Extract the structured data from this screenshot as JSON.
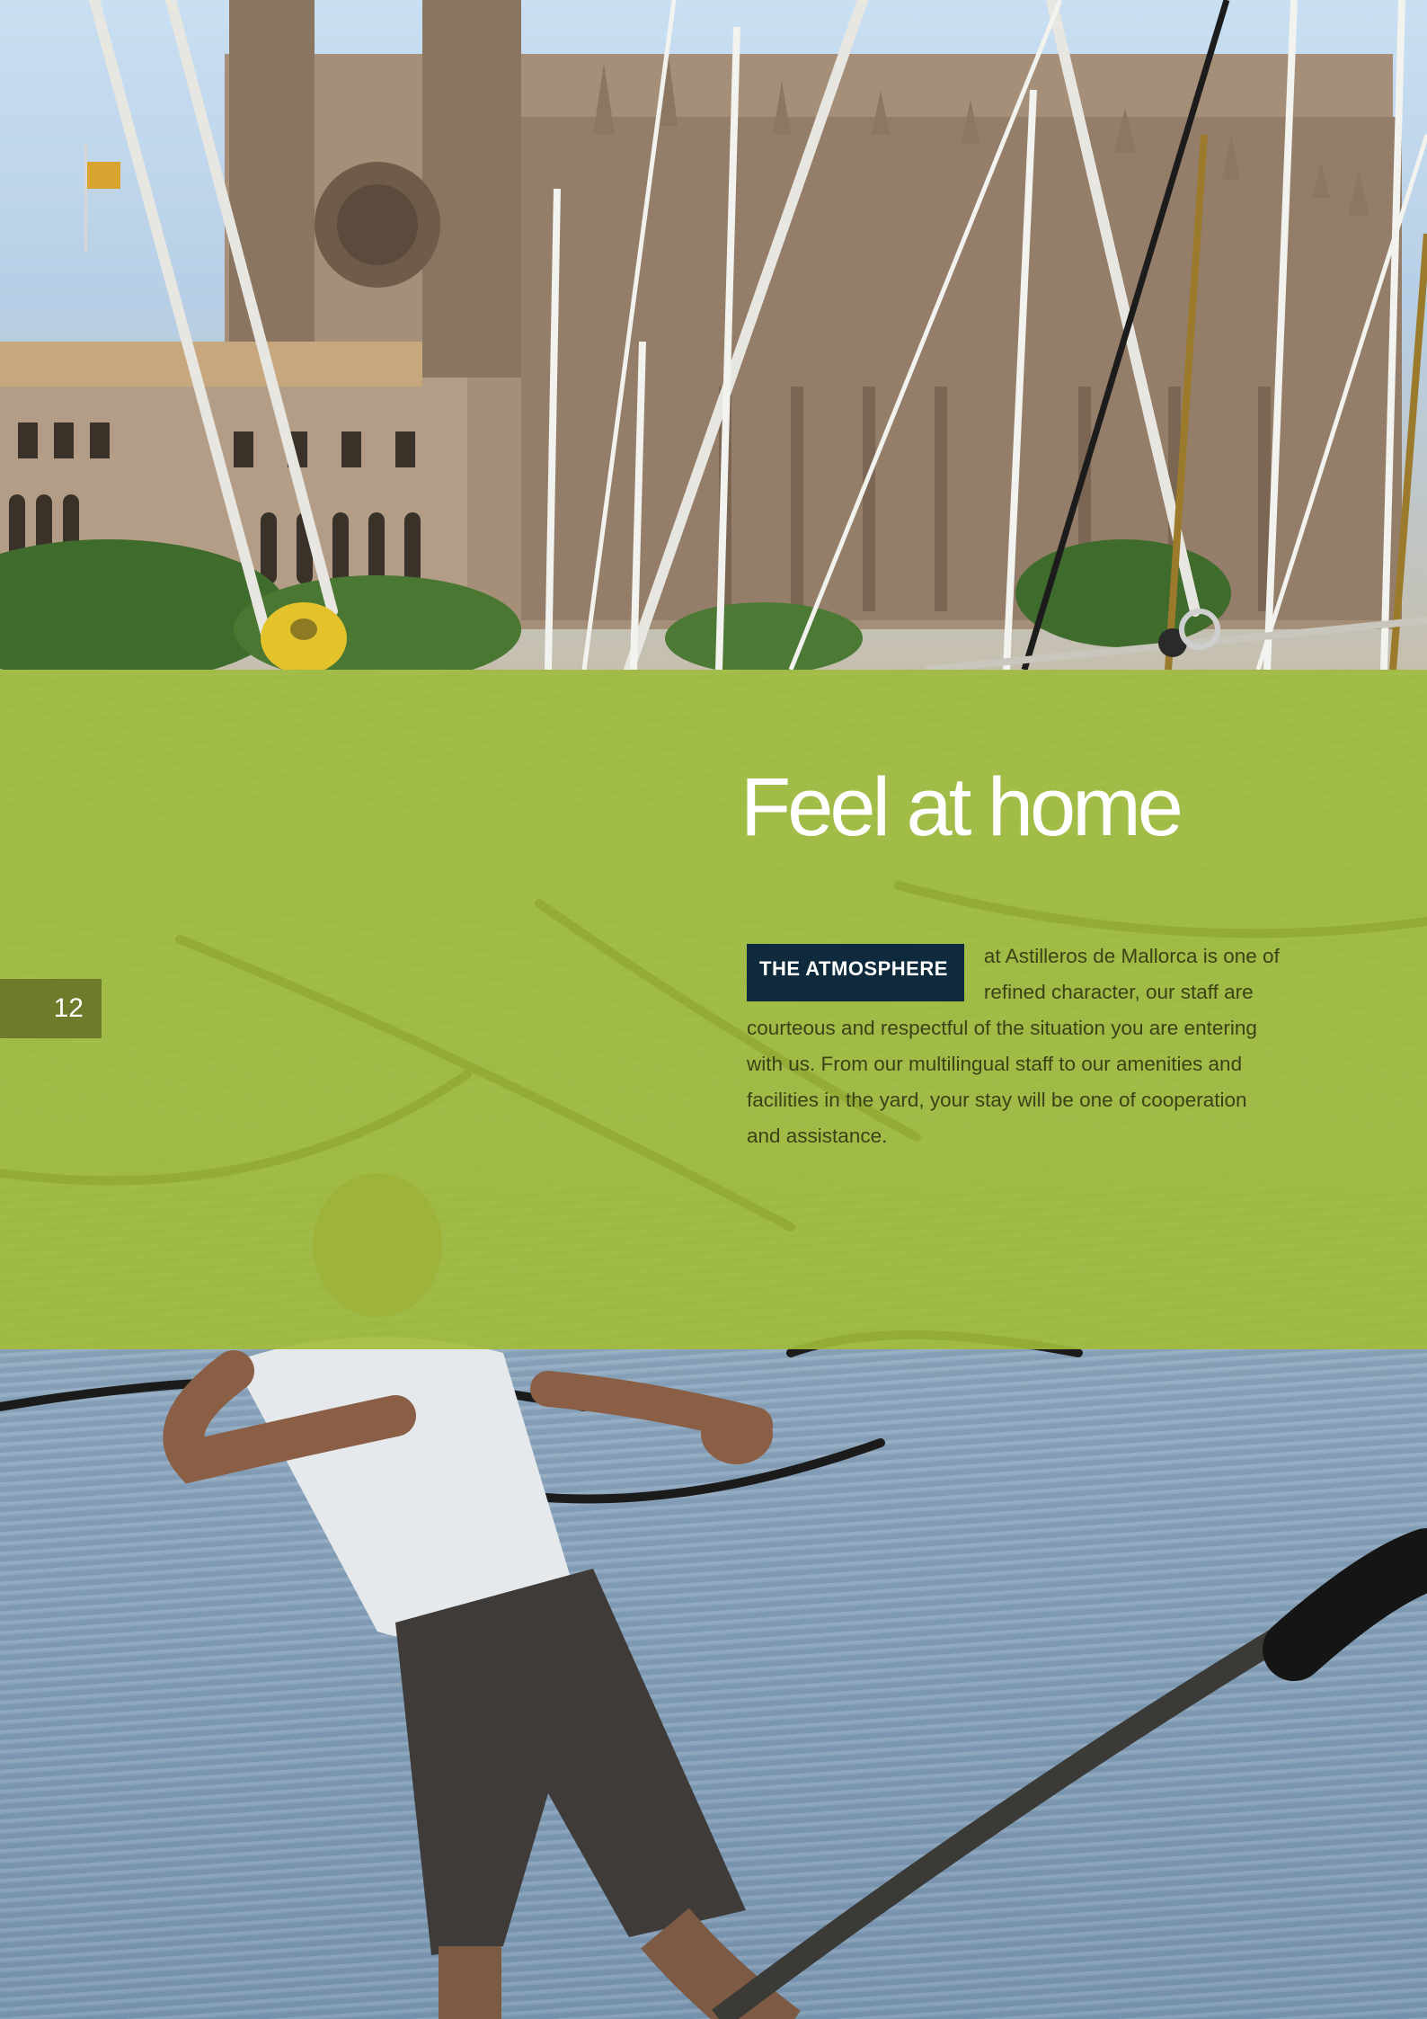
{
  "page": {
    "number": "12"
  },
  "section": {
    "title": "Feel at home",
    "badge_label": "THE ATMOSPHERE",
    "body": "at Astilleros de Mallorca is one of refined character, our staff are courteous and respectful of the situation you are entering with us. From our multilingual staff to our amenities and facilities in the yard, your stay will be one of cooperation and assistance."
  },
  "photos": {
    "top_subject": "cathedral-and-masts-photo",
    "bottom_subject": "sailor-on-bowsprit-photo"
  },
  "colors": {
    "band": "#a1bd38",
    "badge": "#0f2a3c",
    "page_tab": "#6f7a2a",
    "headline": "#ffffff",
    "body_text": "#3b4218"
  }
}
